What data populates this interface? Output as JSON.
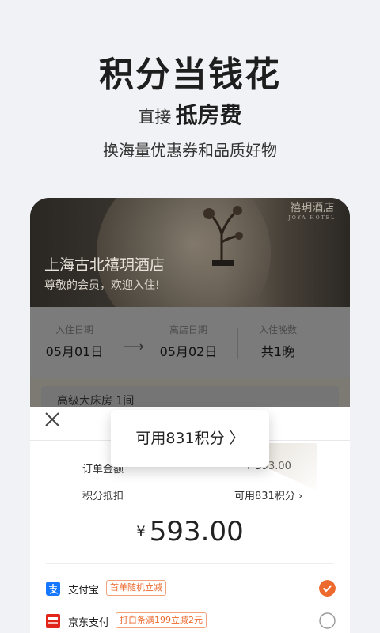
{
  "hero": {
    "title": "积分当钱花",
    "subtitle_small": "直接",
    "subtitle_big": "抵房费",
    "tagline": "换海量优惠券和品质好物"
  },
  "hotel": {
    "brand": "禧玥酒店",
    "brand_en": "JOYA HOTEL",
    "name": "上海古北禧玥酒店",
    "welcome": "尊敬的会员，欢迎入住!"
  },
  "booking": {
    "checkin_label": "入住日期",
    "checkin_value": "05月01日",
    "arrow": "⟶",
    "checkout_label": "离店日期",
    "checkout_value": "05月02日",
    "nights_label": "入住晚数",
    "nights_value": "共1晚",
    "room": "高级大床房 1间"
  },
  "sheet": {
    "popup": "可用831积分 〉",
    "order_label": "订单金额",
    "order_value": "¥ 593.00",
    "points_label": "积分抵扣",
    "points_value": "可用831积分 ›",
    "currency": "¥",
    "total": "593.00"
  },
  "payments": [
    {
      "name": "支付宝",
      "tag": "首单随机立减",
      "checked": true
    },
    {
      "name": "京东支付",
      "tag": "打白条满199立减2元",
      "checked": false
    }
  ],
  "colors": {
    "accent": "#ec6a2e",
    "alipay": "#1677ff",
    "jd": "#e1251b"
  }
}
